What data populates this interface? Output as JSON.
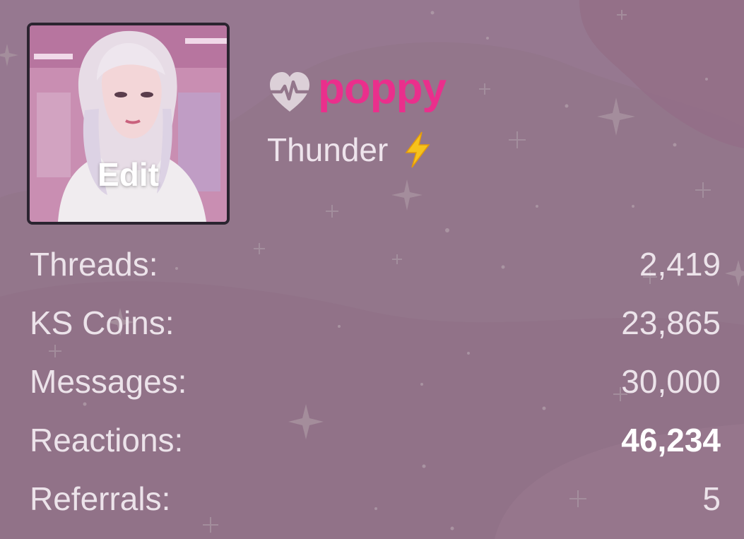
{
  "profile": {
    "username": "poppy",
    "rank_title": "Thunder",
    "avatar_action": "Edit",
    "icons": {
      "username_prefix": "heart-pulse-icon",
      "rank_badge": "lightning-bolt-icon"
    }
  },
  "stats": [
    {
      "label": "Threads:",
      "value": "2,419"
    },
    {
      "label": "KS Coins:",
      "value": "23,865"
    },
    {
      "label": "Messages:",
      "value": "30,000"
    },
    {
      "label": "Reactions:",
      "value": "46,234"
    },
    {
      "label": "Referrals:",
      "value": "5"
    }
  ],
  "colors": {
    "background": "#93768b",
    "username": "#ea2f8c",
    "text": "#ece3ea",
    "avatar_border": "#2b2430",
    "bolt": "#f6c21b"
  }
}
